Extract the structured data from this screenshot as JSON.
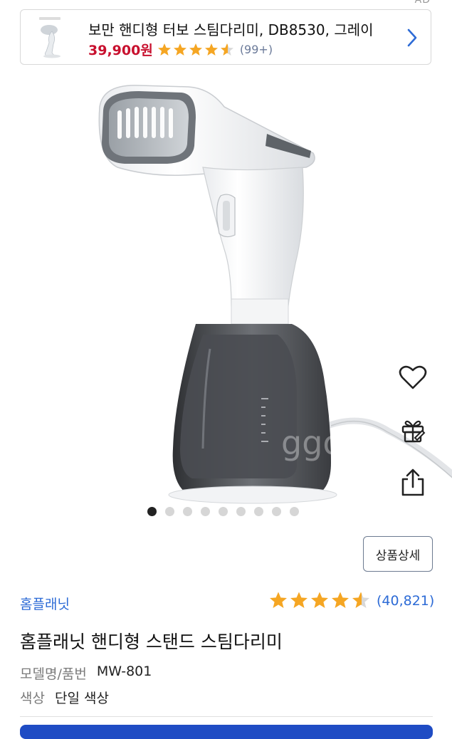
{
  "ad": {
    "tag": "AD",
    "title": "보만 핸디형 터보 스팀다리미, DB8530, 그레이",
    "price": "39,900원",
    "rating": 4.5,
    "review_count": "(99+)",
    "star_color": "#f5a623"
  },
  "product": {
    "watermark": "ggora",
    "image_dots_total": 9,
    "image_dots_active": 1,
    "detail_button_label": "상품상세",
    "brand": "홈플래닛",
    "rating": 4.5,
    "review_count": "(40,821)",
    "title": "홈플래닛 핸디형 스탠드 스팀다리미",
    "specs": [
      {
        "label": "모델명/품번",
        "value": "MW-801"
      },
      {
        "label": "색상",
        "value": "단일 색상"
      }
    ]
  },
  "icons": {
    "wishlist": "heart-icon",
    "gift": "gift-icon",
    "share": "share-icon",
    "chevron": "chevron-right-icon"
  },
  "colors": {
    "accent_blue": "#2d6bd6",
    "price_red": "#c8102e",
    "star": "#f5a623",
    "buy_button": "#1f4cc4"
  }
}
